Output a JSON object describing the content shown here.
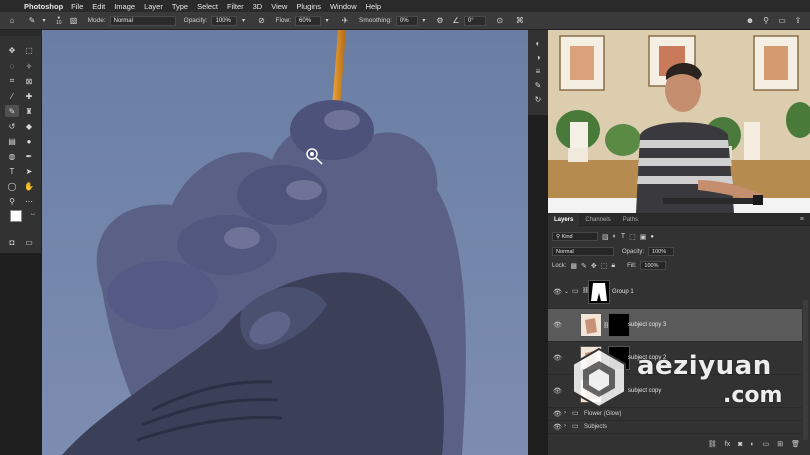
{
  "menubar": {
    "app_name": "Photoshop",
    "items": [
      "File",
      "Edit",
      "Image",
      "Layer",
      "Type",
      "Select",
      "Filter",
      "3D",
      "View",
      "Plugins",
      "Window",
      "Help"
    ]
  },
  "options_bar": {
    "brush_size": "10",
    "mode_label": "Mode:",
    "mode_value": "Normal",
    "opacity_label": "Opacity:",
    "opacity_value": "100%",
    "flow_label": "Flow:",
    "flow_value": "60%",
    "smoothing_label": "Smoothing:",
    "smoothing_value": "0%",
    "angle_value": "0°"
  },
  "layers_panel": {
    "tabs": [
      "Layers",
      "Channels",
      "Paths"
    ],
    "filter_kind": "Kind",
    "blend_mode": "Normal",
    "opacity_label": "Opacity:",
    "opacity_value": "100%",
    "lock_label": "Lock:",
    "fill_label": "Fill:",
    "fill_value": "100%",
    "layers": [
      {
        "name": "Group 1",
        "type": "group",
        "selected": false
      },
      {
        "name": "subject copy 3",
        "type": "layer",
        "selected": true
      },
      {
        "name": "subject copy 2",
        "type": "layer",
        "selected": false
      },
      {
        "name": "subject copy",
        "type": "layer",
        "selected": false
      },
      {
        "name": "Flower (Glow)",
        "type": "group",
        "selected": false
      },
      {
        "name": "Subjects",
        "type": "group",
        "selected": false
      }
    ]
  },
  "watermark": {
    "line1": "aeziyuan",
    "line2": ".com"
  },
  "colors": {
    "canvas_background": "#6d80a6",
    "panel_bg": "#323232",
    "selected_layer": "#5a5a5a"
  }
}
